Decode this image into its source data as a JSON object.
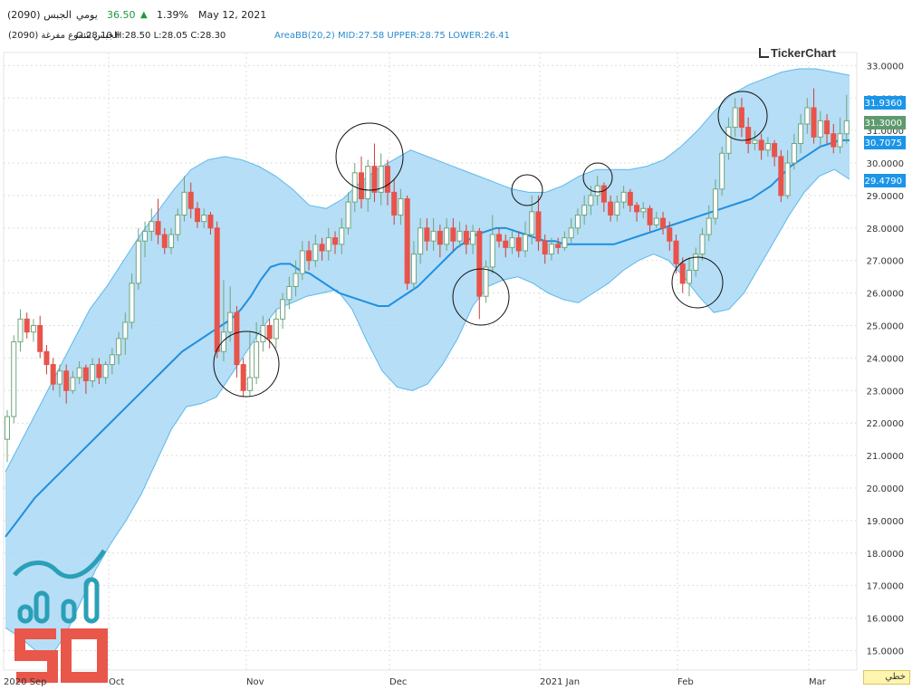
{
  "header": {
    "symbol_name": "الجبس (2090)",
    "period": "يومي",
    "price": "36.50",
    "change_pct": "1.39%",
    "date": "May 12, 2021"
  },
  "info": {
    "series_name": "الجبس شموع مفرغة (2090)",
    "ohlc": "O:28.10 H:28.50 L:28.05 C:28.30",
    "indicator": "AreaBB(20,2)  MID:27.58  UPPER:28.75  LOWER:26.41"
  },
  "brand": "TickerChart",
  "axis_footer": "خطي",
  "colors": {
    "up": "#8fc79c",
    "down": "#e8534a",
    "band_fill": "#a9d8f5",
    "band_line": "#5bb8ec",
    "mid_line": "#1f8fe0",
    "grid": "#dddddd",
    "price_badge": "#5e9a6e",
    "bb_badge": "#1b95e8"
  },
  "chart_data": {
    "type": "candlestick",
    "ylim": [
      14.4,
      33.4
    ],
    "y_ticks": [
      "33.0000",
      "32.0000",
      "31.0000",
      "30.0000",
      "29.0000",
      "28.0000",
      "27.0000",
      "26.0000",
      "25.0000",
      "24.0000",
      "23.0000",
      "22.0000",
      "21.0000",
      "20.0000",
      "19.0000",
      "18.0000",
      "17.0000",
      "16.0000",
      "15.0000"
    ],
    "x_labels": [
      "2020 Sep",
      "Oct",
      "Nov",
      "Dec",
      "2021 Jan",
      "Feb",
      "Mar"
    ],
    "price_badges": [
      {
        "label": "31.9360",
        "kind": "bb"
      },
      {
        "label": "31.3000",
        "kind": "price"
      },
      {
        "label": "30.7075",
        "kind": "bb"
      },
      {
        "label": "29.4790",
        "kind": "bb"
      }
    ],
    "candles": [
      [
        21.5,
        22.2,
        20.8,
        22.4
      ],
      [
        22.2,
        24.5,
        22.0,
        24.7
      ],
      [
        24.5,
        25.2,
        24.2,
        25.5
      ],
      [
        25.2,
        24.8,
        24.6,
        25.4
      ],
      [
        24.8,
        25.0,
        24.5,
        25.2
      ],
      [
        25.0,
        24.2,
        24.0,
        25.3
      ],
      [
        24.2,
        23.8,
        23.5,
        24.4
      ],
      [
        23.8,
        23.2,
        23.0,
        24.0
      ],
      [
        23.2,
        23.6,
        22.8,
        23.8
      ],
      [
        23.6,
        23.0,
        22.6,
        23.8
      ],
      [
        23.0,
        23.4,
        22.9,
        23.6
      ],
      [
        23.4,
        23.7,
        23.2,
        23.9
      ],
      [
        23.7,
        23.3,
        22.9,
        23.8
      ],
      [
        23.3,
        23.8,
        23.1,
        24.0
      ],
      [
        23.8,
        23.4,
        23.2,
        24.0
      ],
      [
        23.4,
        23.8,
        23.2,
        23.9
      ],
      [
        23.8,
        24.1,
        23.5,
        24.3
      ],
      [
        24.1,
        24.6,
        23.8,
        24.8
      ],
      [
        24.6,
        25.1,
        24.1,
        25.4
      ],
      [
        25.1,
        26.3,
        24.9,
        26.6
      ],
      [
        26.3,
        27.6,
        26.1,
        28.0
      ],
      [
        27.6,
        27.9,
        27.1,
        28.2
      ],
      [
        27.9,
        28.2,
        27.6,
        28.6
      ],
      [
        28.2,
        27.8,
        27.5,
        28.9
      ],
      [
        27.8,
        27.4,
        27.2,
        28.0
      ],
      [
        27.4,
        27.8,
        27.2,
        28.0
      ],
      [
        27.8,
        28.4,
        27.6,
        28.6
      ],
      [
        28.4,
        29.1,
        28.2,
        29.6
      ],
      [
        29.1,
        28.6,
        28.3,
        29.4
      ],
      [
        28.6,
        28.2,
        28.0,
        28.8
      ],
      [
        28.2,
        28.4,
        28.0,
        28.6
      ],
      [
        28.4,
        28.0,
        27.8,
        28.5
      ],
      [
        28.0,
        24.2,
        24.0,
        28.2
      ],
      [
        24.2,
        24.8,
        23.9,
        26.4
      ],
      [
        24.8,
        25.4,
        24.5,
        26.2
      ],
      [
        25.4,
        23.8,
        23.4,
        25.6
      ],
      [
        23.8,
        23.0,
        22.8,
        24.0
      ],
      [
        23.0,
        23.4,
        22.8,
        24.8
      ],
      [
        23.4,
        24.5,
        23.2,
        25.1
      ],
      [
        24.5,
        25.0,
        24.2,
        25.3
      ],
      [
        25.0,
        24.6,
        24.3,
        25.2
      ],
      [
        24.6,
        25.2,
        24.3,
        25.5
      ],
      [
        25.2,
        25.8,
        24.9,
        26.0
      ],
      [
        25.8,
        26.2,
        25.5,
        26.5
      ],
      [
        26.2,
        26.6,
        25.9,
        27.0
      ],
      [
        26.6,
        27.3,
        26.4,
        27.6
      ],
      [
        27.3,
        27.0,
        26.7,
        27.6
      ],
      [
        27.0,
        27.5,
        26.8,
        27.8
      ],
      [
        27.5,
        27.3,
        27.0,
        27.7
      ],
      [
        27.3,
        27.7,
        27.0,
        28.0
      ],
      [
        27.7,
        27.5,
        27.2,
        27.9
      ],
      [
        27.5,
        28.0,
        27.2,
        28.3
      ],
      [
        28.0,
        28.8,
        27.8,
        29.1
      ],
      [
        28.8,
        29.7,
        28.5,
        30.0
      ],
      [
        29.7,
        28.9,
        28.6,
        30.2
      ],
      [
        28.9,
        29.9,
        28.5,
        30.1
      ],
      [
        29.9,
        29.1,
        28.8,
        30.6
      ],
      [
        29.1,
        29.9,
        28.7,
        30.3
      ],
      [
        29.9,
        29.1,
        28.7,
        30.1
      ],
      [
        29.1,
        28.4,
        28.1,
        29.5
      ],
      [
        28.4,
        28.9,
        28.1,
        29.2
      ],
      [
        28.9,
        26.3,
        26.1,
        29.0
      ],
      [
        26.3,
        27.2,
        26.1,
        27.6
      ],
      [
        27.2,
        28.0,
        26.9,
        28.3
      ],
      [
        28.0,
        27.6,
        27.3,
        28.3
      ],
      [
        27.6,
        27.9,
        27.3,
        28.3
      ],
      [
        27.9,
        27.5,
        27.1,
        28.1
      ],
      [
        27.5,
        28.0,
        27.3,
        28.3
      ],
      [
        28.0,
        27.6,
        27.3,
        28.3
      ],
      [
        27.6,
        27.9,
        27.4,
        28.2
      ],
      [
        27.9,
        27.5,
        27.2,
        28.1
      ],
      [
        27.5,
        27.9,
        27.2,
        28.1
      ],
      [
        27.9,
        25.9,
        25.2,
        28.0
      ],
      [
        25.9,
        26.8,
        25.7,
        27.0
      ],
      [
        26.8,
        27.8,
        26.6,
        28.4
      ],
      [
        27.8,
        27.6,
        27.4,
        28.0
      ],
      [
        27.6,
        27.4,
        27.1,
        27.8
      ],
      [
        27.4,
        27.7,
        27.2,
        27.9
      ],
      [
        27.7,
        27.3,
        27.1,
        27.9
      ],
      [
        27.3,
        27.8,
        27.1,
        28.2
      ],
      [
        27.8,
        28.5,
        27.5,
        29.0
      ],
      [
        28.5,
        27.6,
        27.3,
        29.0
      ],
      [
        27.6,
        27.2,
        26.9,
        27.8
      ],
      [
        27.2,
        27.5,
        27.0,
        27.7
      ],
      [
        27.5,
        27.4,
        27.2,
        27.7
      ],
      [
        27.4,
        27.7,
        27.3,
        27.9
      ],
      [
        27.7,
        28.0,
        27.5,
        28.3
      ],
      [
        28.0,
        28.4,
        27.8,
        28.6
      ],
      [
        28.4,
        28.7,
        28.1,
        29.0
      ],
      [
        28.7,
        29.0,
        28.4,
        29.3
      ],
      [
        29.0,
        29.3,
        28.7,
        29.6
      ],
      [
        29.3,
        28.8,
        28.5,
        29.4
      ],
      [
        28.8,
        28.4,
        28.2,
        29.0
      ],
      [
        28.4,
        28.8,
        28.2,
        29.0
      ],
      [
        28.8,
        29.1,
        28.6,
        29.3
      ],
      [
        29.1,
        28.7,
        28.5,
        29.2
      ],
      [
        28.7,
        28.5,
        28.2,
        28.8
      ],
      [
        28.5,
        28.6,
        28.3,
        28.8
      ],
      [
        28.6,
        28.1,
        27.9,
        28.7
      ],
      [
        28.1,
        28.3,
        28.0,
        28.5
      ],
      [
        28.3,
        28.0,
        27.8,
        28.5
      ],
      [
        28.0,
        27.6,
        27.3,
        28.2
      ],
      [
        27.6,
        26.9,
        26.6,
        27.8
      ],
      [
        26.9,
        26.3,
        26.0,
        27.1
      ],
      [
        26.3,
        26.7,
        25.9,
        27.1
      ],
      [
        26.7,
        27.2,
        26.5,
        27.4
      ],
      [
        27.2,
        27.8,
        27.0,
        28.0
      ],
      [
        27.8,
        28.3,
        27.6,
        28.7
      ],
      [
        28.3,
        29.2,
        28.1,
        29.5
      ],
      [
        29.2,
        30.3,
        29.0,
        30.5
      ],
      [
        30.3,
        31.1,
        30.1,
        31.4
      ],
      [
        31.1,
        31.7,
        30.8,
        32.0
      ],
      [
        31.7,
        31.1,
        30.8,
        32.0
      ],
      [
        31.1,
        30.6,
        30.3,
        31.4
      ],
      [
        30.6,
        30.7,
        30.4,
        31.0
      ],
      [
        30.7,
        30.4,
        30.1,
        30.9
      ],
      [
        30.4,
        30.6,
        30.2,
        30.8
      ],
      [
        30.6,
        30.2,
        29.9,
        30.7
      ],
      [
        30.2,
        29.0,
        28.8,
        30.4
      ],
      [
        29.0,
        30.0,
        28.9,
        30.4
      ],
      [
        30.0,
        30.6,
        29.8,
        30.9
      ],
      [
        30.6,
        31.2,
        30.3,
        31.5
      ],
      [
        31.2,
        31.7,
        30.9,
        32.0
      ],
      [
        31.7,
        30.8,
        30.6,
        32.3
      ],
      [
        30.8,
        31.3,
        30.5,
        31.6
      ],
      [
        31.3,
        30.9,
        30.6,
        31.5
      ],
      [
        30.9,
        30.5,
        30.3,
        31.2
      ],
      [
        30.5,
        30.9,
        30.3,
        31.4
      ],
      [
        30.9,
        31.3,
        30.6,
        32.1
      ]
    ],
    "mid": [
      18.5,
      18.9,
      19.3,
      19.7,
      20.0,
      20.3,
      20.6,
      20.9,
      21.2,
      21.5,
      21.8,
      22.1,
      22.4,
      22.7,
      23.0,
      23.3,
      23.6,
      23.9,
      24.2,
      24.4,
      24.6,
      24.8,
      25.0,
      25.2,
      25.5,
      25.9,
      26.4,
      26.8,
      26.9,
      26.9,
      26.7,
      26.6,
      26.4,
      26.2,
      26.0,
      25.9,
      25.8,
      25.7,
      25.6,
      25.6,
      25.8,
      26.0,
      26.2,
      26.5,
      26.8,
      27.1,
      27.4,
      27.6,
      27.8,
      27.9,
      28.0,
      28.0,
      27.9,
      27.8,
      27.7,
      27.6,
      27.6,
      27.5,
      27.5,
      27.5,
      27.5,
      27.5,
      27.5,
      27.6,
      27.7,
      27.8,
      27.9,
      28.0,
      28.1,
      28.2,
      28.3,
      28.4,
      28.5,
      28.6,
      28.7,
      28.8,
      28.9,
      29.1,
      29.3,
      29.6,
      29.9,
      30.1,
      30.3,
      30.5,
      30.6,
      30.7,
      30.7
    ],
    "upper": [
      20.5,
      21.5,
      22.5,
      23.5,
      24.5,
      25.5,
      26.2,
      27.0,
      27.8,
      28.5,
      29.2,
      29.8,
      30.1,
      30.2,
      30.1,
      29.9,
      29.6,
      29.2,
      28.7,
      28.6,
      28.9,
      29.4,
      29.8,
      30.1,
      30.4,
      30.2,
      30.0,
      29.8,
      29.6,
      29.4,
      29.2,
      29.1,
      29.1,
      29.3,
      29.6,
      29.8,
      29.8,
      29.8,
      29.9,
      30.1,
      30.5,
      31.0,
      31.6,
      32.1,
      32.4,
      32.6,
      32.8,
      32.9,
      32.9,
      32.8,
      32.7
    ],
    "lower": [
      15.7,
      15.4,
      15.0,
      14.8,
      15.5,
      16.5,
      17.5,
      18.3,
      19.0,
      19.8,
      20.8,
      21.8,
      22.5,
      22.6,
      22.8,
      23.5,
      24.2,
      24.9,
      25.5,
      25.7,
      25.9,
      26.0,
      26.1,
      25.5,
      24.5,
      23.6,
      23.1,
      23.0,
      23.2,
      23.8,
      24.6,
      25.6,
      26.2,
      26.4,
      26.5,
      26.3,
      26.0,
      25.8,
      25.7,
      26.0,
      26.3,
      26.7,
      27.0,
      27.2,
      27.0,
      26.5,
      25.9,
      25.4,
      25.5,
      26.0,
      26.8,
      27.6,
      28.4,
      29.1,
      29.6,
      29.8,
      29.5
    ]
  }
}
